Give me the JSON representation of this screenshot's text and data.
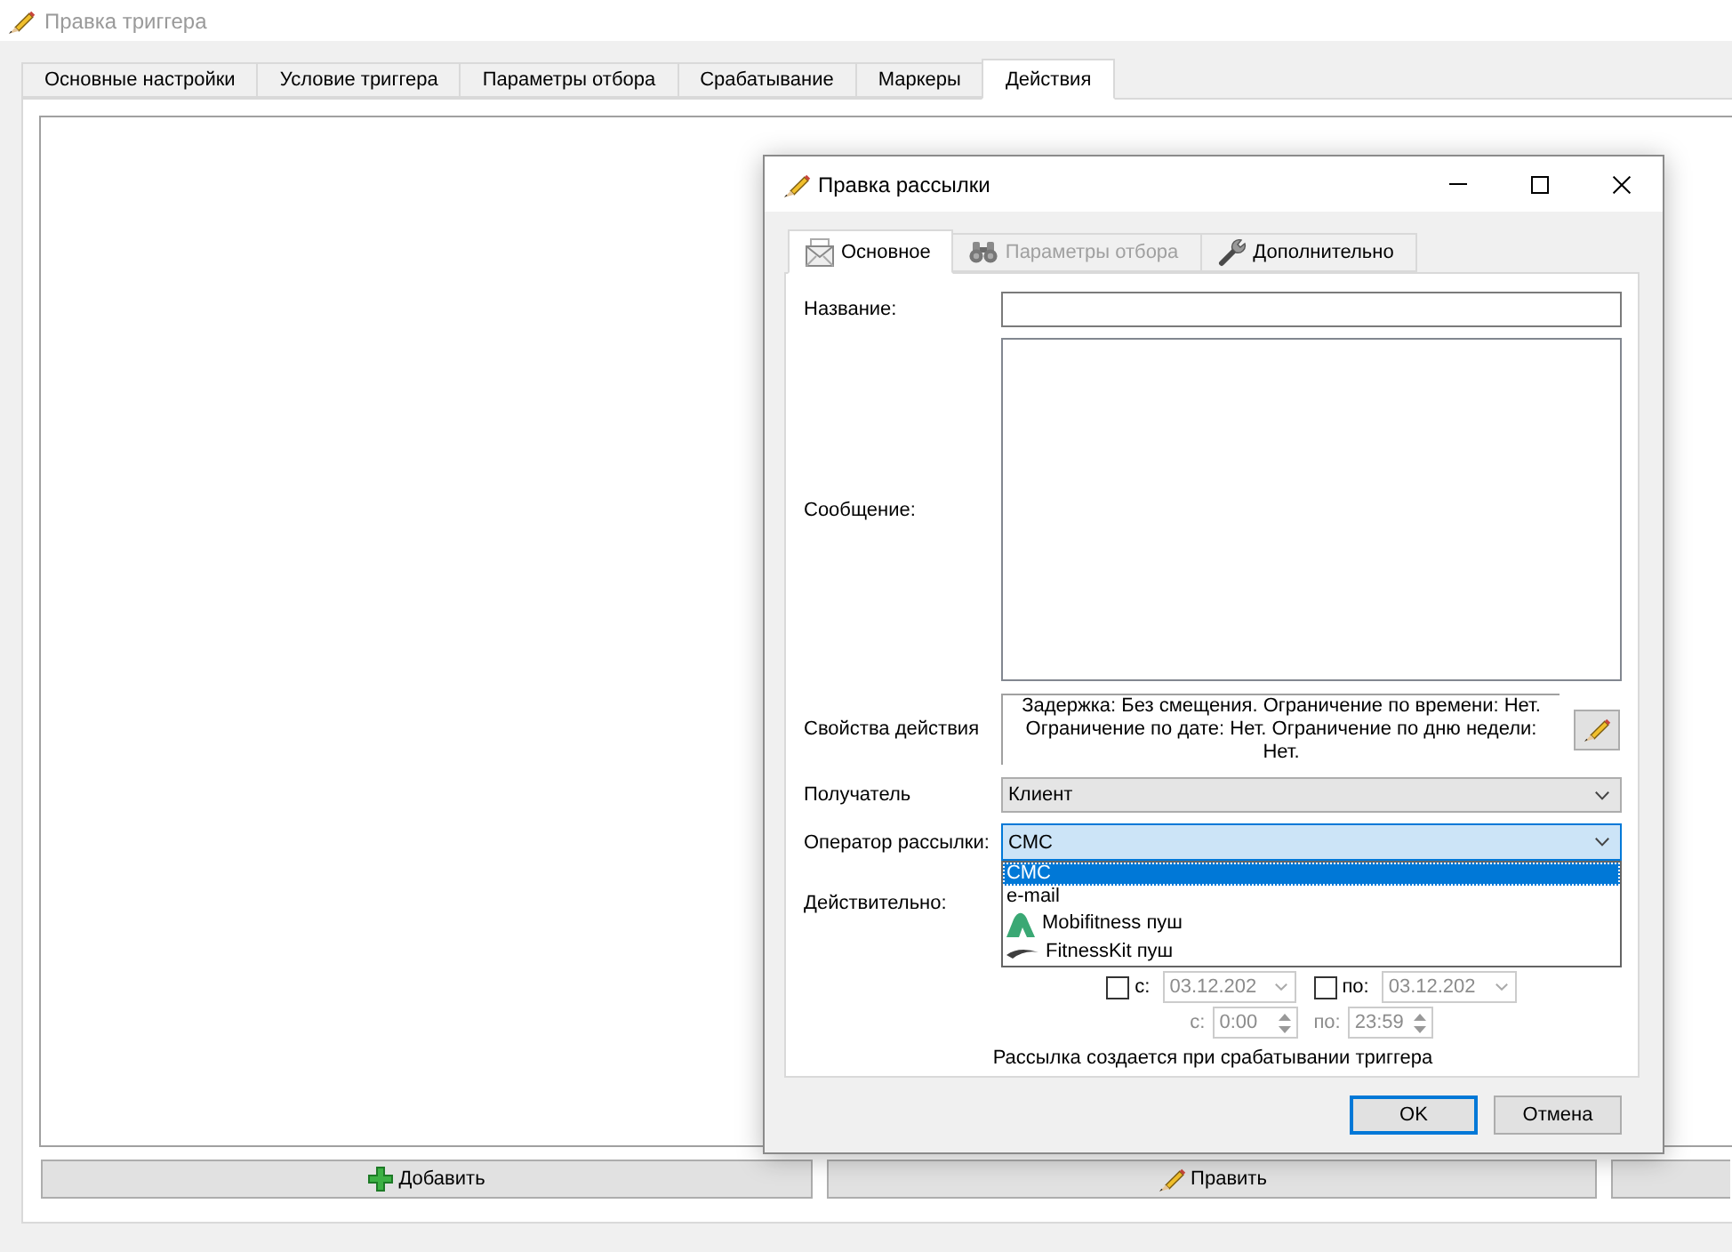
{
  "main_window": {
    "title": "Правка триггера",
    "active": false,
    "tabs": [
      {
        "label": "Основные настройки",
        "selected": false
      },
      {
        "label": "Условие триггера",
        "selected": false
      },
      {
        "label": "Параметры отбора",
        "selected": false
      },
      {
        "label": "Срабатывание",
        "selected": false
      },
      {
        "label": "Маркеры",
        "selected": false
      },
      {
        "label": "Действия",
        "selected": true
      }
    ],
    "buttons": [
      {
        "kind": "add",
        "label": "Добавить"
      },
      {
        "kind": "edit",
        "label": "Править"
      },
      {
        "kind": "blank"
      }
    ]
  },
  "dialog": {
    "title": "Правка рассылки",
    "active": true,
    "tabs": [
      {
        "label": "Основное",
        "selected": true,
        "disabled": false
      },
      {
        "label": "Параметры отбора",
        "selected": false,
        "disabled": true
      },
      {
        "label": "Дополнительно",
        "selected": false,
        "disabled": false
      }
    ],
    "form": {
      "name": {
        "label": "Название:"
      },
      "message": {
        "label": "Сообщение:"
      },
      "action_properties": {
        "label": "Свойства действия",
        "text": "Задержка: Без смещения. Ограничение по времени: Нет. Ограничение по дате: Нет. Ограничение по дню недели: Нет."
      },
      "recipient": {
        "label": "Получатель",
        "value": "Клиент",
        "expanded": false
      },
      "operator": {
        "label": "Оператор рассылки:",
        "value": "СМС",
        "expanded": true,
        "options": [
          {
            "label": "СМС",
            "selected": true
          },
          {
            "label": "e-mail",
            "selected": false
          },
          {
            "label": "Mobifitness пуш",
            "selected": false
          },
          {
            "label": "FitnessKit пуш",
            "selected": false
          }
        ]
      },
      "validity": {
        "label": "Действительно:",
        "disabled": true,
        "date_from": {
          "label": "с:",
          "checked": false,
          "value": "03.12.202"
        },
        "date_to": {
          "label": "по:",
          "checked": false,
          "value": "03.12.202"
        },
        "time_from": {
          "label": "с:",
          "value": "0:00"
        },
        "time_to": {
          "label": "по:",
          "value": "23:59"
        }
      }
    },
    "note": "Рассылка создается при срабатывании триггера",
    "buttons": [
      {
        "label": "OK",
        "default": true
      },
      {
        "label": "Отмена",
        "default": false
      }
    ]
  }
}
